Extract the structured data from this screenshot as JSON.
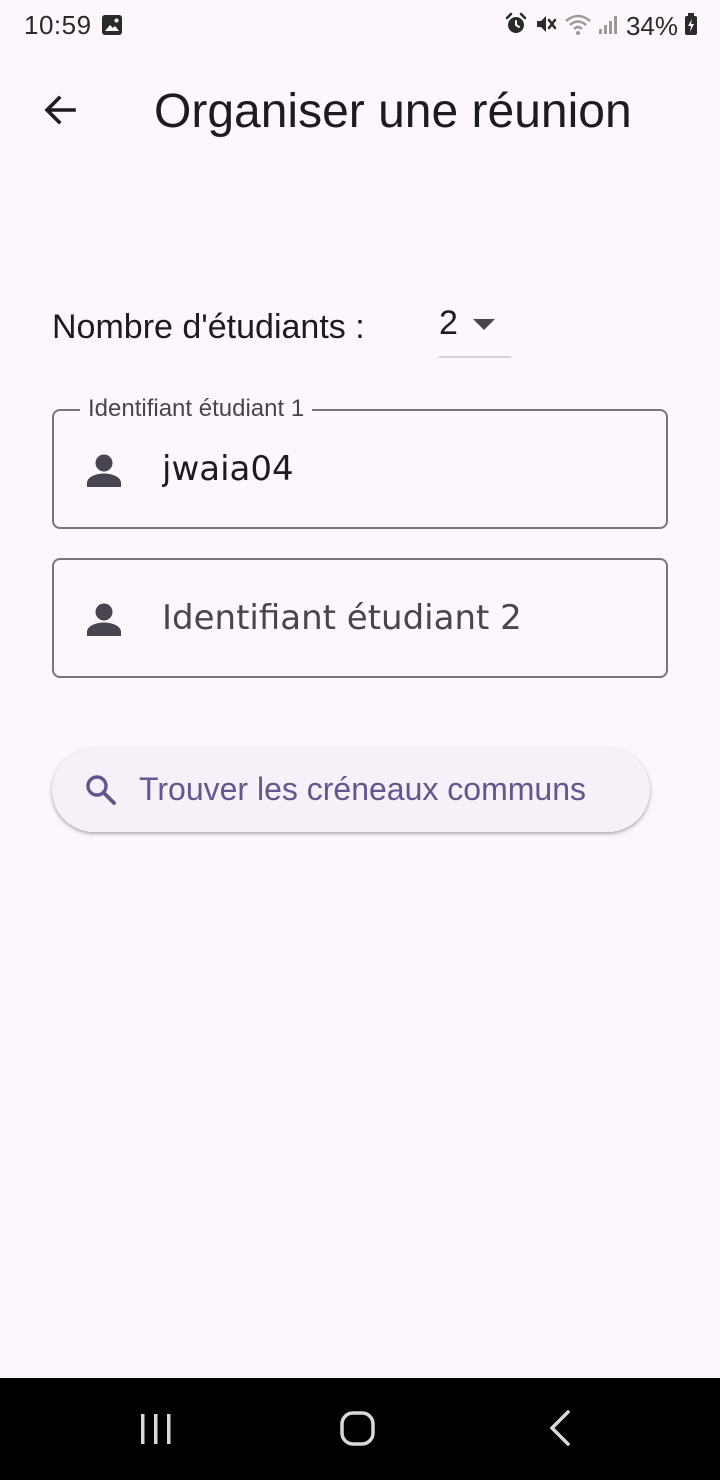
{
  "status_bar": {
    "time": "10:59",
    "battery_text": "34%",
    "icons": [
      "gallery-icon",
      "alarm-icon",
      "mute-icon",
      "wifi-icon",
      "signal-icon",
      "battery-icon"
    ]
  },
  "app_bar": {
    "title": "Organiser une réunion",
    "back_icon": "arrow-back-icon"
  },
  "student_count": {
    "label": "Nombre d'étudiants :",
    "selected_value": "2",
    "caret_icon": "dropdown-caret-icon"
  },
  "fields": [
    {
      "label": "Identifiant étudiant 1",
      "value": "jwaia04",
      "placeholder": "",
      "icon": "person-icon"
    },
    {
      "label": "Identifiant étudiant 2",
      "value": "",
      "placeholder": "Identifiant étudiant 2",
      "icon": "person-icon"
    }
  ],
  "search_button": {
    "label": "Trouver les créneaux communs",
    "icon": "search-icon"
  },
  "colors": {
    "background": "#fdf7fd",
    "primary": "#65558f",
    "outline": "#79747e",
    "on_surface": "#1d1b20",
    "nav_bar": "#000000"
  },
  "nav_bar": {
    "icons": [
      "recents-icon",
      "home-icon",
      "back-nav-icon"
    ]
  }
}
